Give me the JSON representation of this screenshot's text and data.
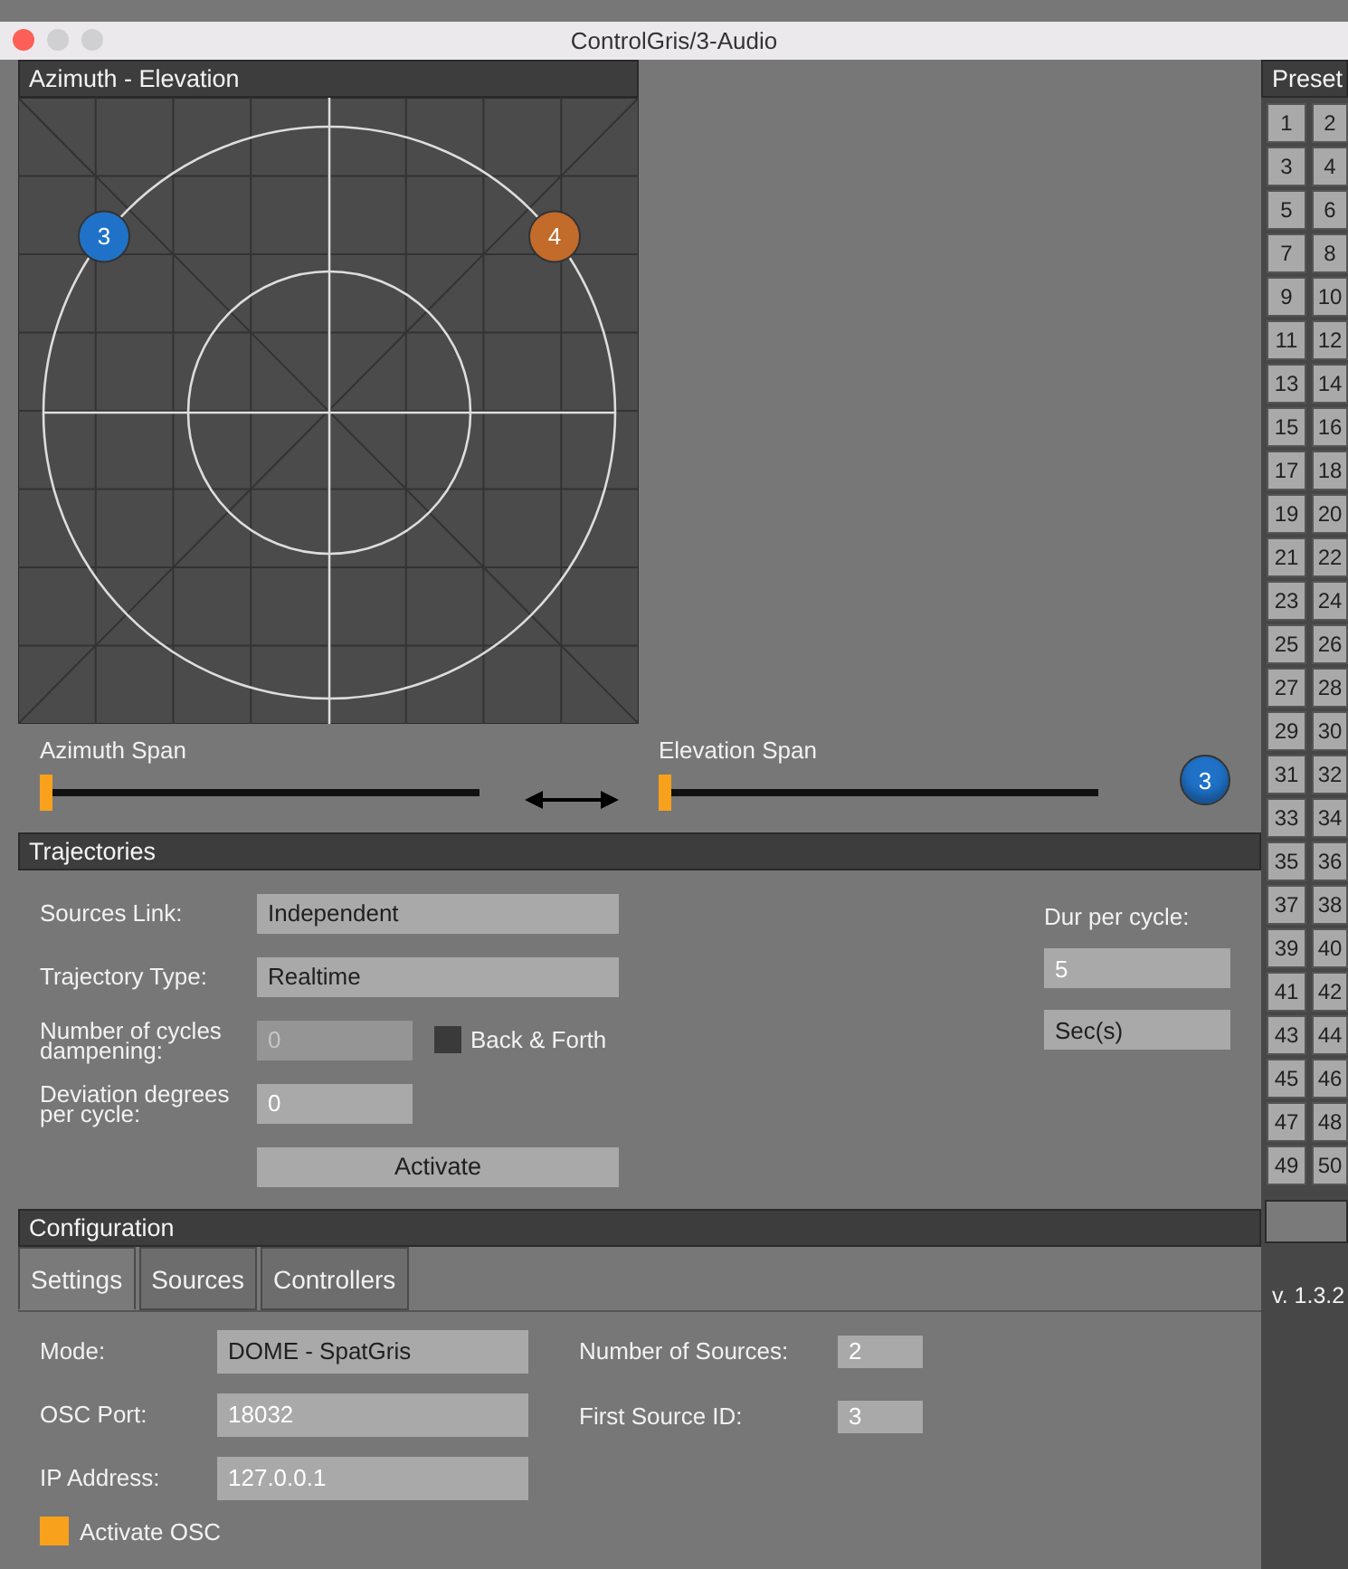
{
  "window": {
    "title": "ControlGris/3-Audio"
  },
  "field": {
    "title": "Azimuth - Elevation",
    "sources": [
      {
        "label": "3",
        "color": "#1f72c8"
      },
      {
        "label": "4",
        "color": "#c26b2a"
      }
    ]
  },
  "spans": {
    "azimuth": {
      "label": "Azimuth Span",
      "level": 0
    },
    "elevation": {
      "label": "Elevation Span",
      "level": 0
    },
    "selected_source": {
      "label": "3",
      "color": "#1f72c8"
    }
  },
  "trajectories": {
    "title": "Trajectories",
    "sources_link": {
      "label": "Sources Link:",
      "value": "Independent"
    },
    "trajectory_type": {
      "label": "Trajectory Type:",
      "value": "Realtime"
    },
    "cycles_dampening": {
      "label": "Number of cycles dampening:",
      "value": "0",
      "disabled": true
    },
    "back_forth": {
      "label": "Back & Forth",
      "checked": false
    },
    "deviation": {
      "label": "Deviation degrees per cycle:",
      "value": "0",
      "disabled": false
    },
    "activate": "Activate",
    "duration": {
      "label": "Dur per cycle:",
      "value": "5",
      "unit": "Sec(s)"
    }
  },
  "configuration": {
    "title": "Configuration",
    "tabs": [
      {
        "label": "Settings",
        "selected": true
      },
      {
        "label": "Sources",
        "selected": false
      },
      {
        "label": "Controllers",
        "selected": false
      }
    ],
    "fields": [
      {
        "label": "Mode:",
        "value": "DOME - SpatGris",
        "kind": "combo"
      },
      {
        "label": "OSC Port:",
        "value": "18032",
        "kind": "number"
      },
      {
        "label": "IP Address:",
        "value": "127.0.0.1",
        "kind": "number"
      }
    ],
    "side_fields": [
      {
        "label": "Number of Sources:",
        "value": "2"
      },
      {
        "label": "First Source ID:",
        "value": "3"
      }
    ],
    "activate_osc": {
      "label": "Activate OSC",
      "checked": true
    }
  },
  "presets": {
    "title": "Preset",
    "buttons": [
      "1",
      "2",
      "3",
      "4",
      "5",
      "6",
      "7",
      "8",
      "9",
      "10",
      "11",
      "12",
      "13",
      "14",
      "15",
      "16",
      "17",
      "18",
      "19",
      "20",
      "21",
      "22",
      "23",
      "24",
      "25",
      "26",
      "27",
      "28",
      "29",
      "30",
      "31",
      "32",
      "33",
      "34",
      "35",
      "36",
      "37",
      "38",
      "39",
      "40",
      "41",
      "42",
      "43",
      "44",
      "45",
      "46",
      "47",
      "48",
      "49",
      "50"
    ],
    "version": "v. 1.3.2"
  }
}
